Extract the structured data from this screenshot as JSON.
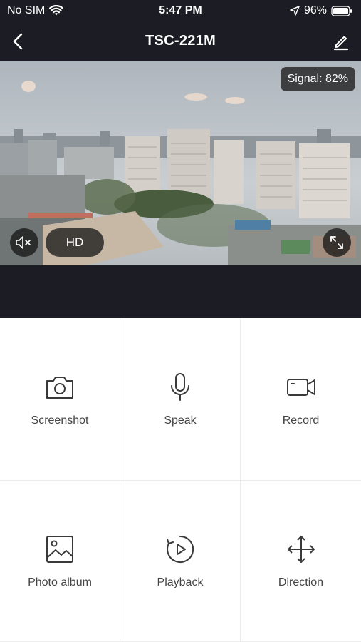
{
  "status_bar": {
    "carrier": "No SIM",
    "time": "5:47 PM",
    "battery": "96%",
    "icons": [
      "wifi-icon",
      "location-arrow-icon",
      "battery-icon"
    ]
  },
  "nav": {
    "title": "TSC-221M",
    "icons": [
      "chevron-left-icon",
      "pencil-icon"
    ]
  },
  "video": {
    "signal_label": "Signal: 82%",
    "quality_label": "HD",
    "icons": [
      "speaker-muted-icon",
      "fullscreen-icon"
    ]
  },
  "controls": [
    {
      "label": "Screenshot",
      "icon": "camera-icon"
    },
    {
      "label": "Speak",
      "icon": "microphone-icon"
    },
    {
      "label": "Record",
      "icon": "video-camera-icon"
    },
    {
      "label": "Photo album",
      "icon": "image-icon"
    },
    {
      "label": "Playback",
      "icon": "playback-icon"
    },
    {
      "label": "Direction",
      "icon": "move-arrows-icon"
    }
  ],
  "colors": {
    "dark_bg": "#1c1d24",
    "icon_color": "#3a3a3a",
    "divider": "#ececec"
  }
}
